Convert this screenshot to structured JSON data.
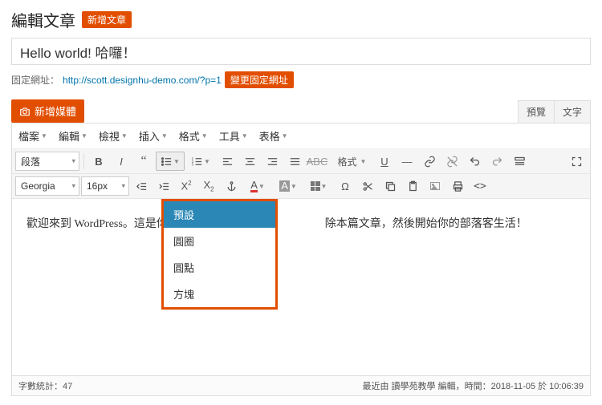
{
  "header": {
    "title": "編輯文章",
    "add_new": "新增文章"
  },
  "post": {
    "title_value": "Hello world! 哈囉！",
    "permalink_label": "固定網址：",
    "permalink_url": "http://scott.designhu-demo.com/?p=1",
    "change_permalink": "變更固定網址"
  },
  "media": {
    "add_media": "新增媒體"
  },
  "tabs": {
    "visual": "預覽",
    "text": "文字"
  },
  "menubar": [
    "檔案",
    "編輯",
    "檢視",
    "插入",
    "格式",
    "工具",
    "表格"
  ],
  "row1": {
    "blockformat": "段落",
    "style_label": "格式"
  },
  "row2": {
    "font": "Georgia",
    "size": "16px"
  },
  "list_dropdown": {
    "items": [
      "預設",
      "圓圈",
      "圓點",
      "方塊"
    ],
    "selected_index": 0
  },
  "content": {
    "body": "歡迎來到 WordPress。這是你　　　　　　　　　　　　　　除本篇文章，然後開始你的部落客生活！"
  },
  "status": {
    "wordcount_label": "字數統計：",
    "wordcount": "47",
    "last_edit": "最近由 讀學苑教學 編輯，時間：2018-11-05 於 10:06:39"
  }
}
